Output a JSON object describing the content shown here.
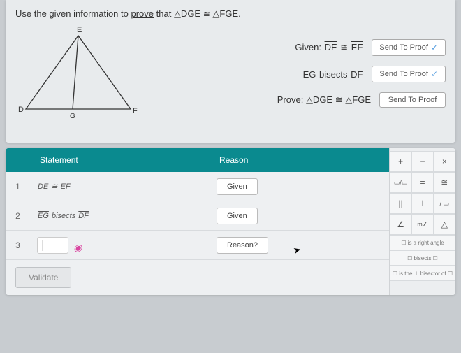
{
  "prompt": {
    "prefix": "Use the given information to ",
    "prove": "prove",
    "middle": " that ",
    "triangle1": "△DGE",
    "cong": "≅",
    "triangle2": "△FGE",
    "suffix": "."
  },
  "diagram": {
    "vertices": {
      "D": "D",
      "E": "E",
      "F": "F",
      "G": "G"
    }
  },
  "info": {
    "givenLabel": "Given:",
    "given1": {
      "seg1": "DE",
      "rel": "≅",
      "seg2": "EF"
    },
    "given2": {
      "seg1": "EG",
      "verb": "bisects",
      "seg2": "DF"
    },
    "proveLabel": "Prove:",
    "prove": {
      "t1": "△DGE",
      "rel": "≅",
      "t2": "△FGE"
    },
    "sendBtn": "Send To Proof"
  },
  "headers": {
    "statement": "Statement",
    "reason": "Reason"
  },
  "rows": [
    {
      "num": "1",
      "stmt": {
        "seg1": "DE",
        "rel": "≅",
        "seg2": "EF"
      },
      "reason": "Given"
    },
    {
      "num": "2",
      "stmt": {
        "seg1": "EG",
        "verb": "bisects",
        "seg2": "DF"
      },
      "reason": "Given"
    },
    {
      "num": "3",
      "stmt": "",
      "reason": "Reason?"
    }
  ],
  "validate": "Validate",
  "toolbar": {
    "r1": [
      "+",
      "−",
      "×"
    ],
    "r2": [
      "▭/▭",
      "=",
      "≅"
    ],
    "r3": [
      "||",
      "⊥",
      "/ ▭"
    ],
    "r4": [
      "∠",
      "m∠",
      "△"
    ],
    "wide1": "☐ is a right angle",
    "wide2": "☐ bisects ☐",
    "wide3": "☐ is the ⊥ bisector of ☐"
  }
}
